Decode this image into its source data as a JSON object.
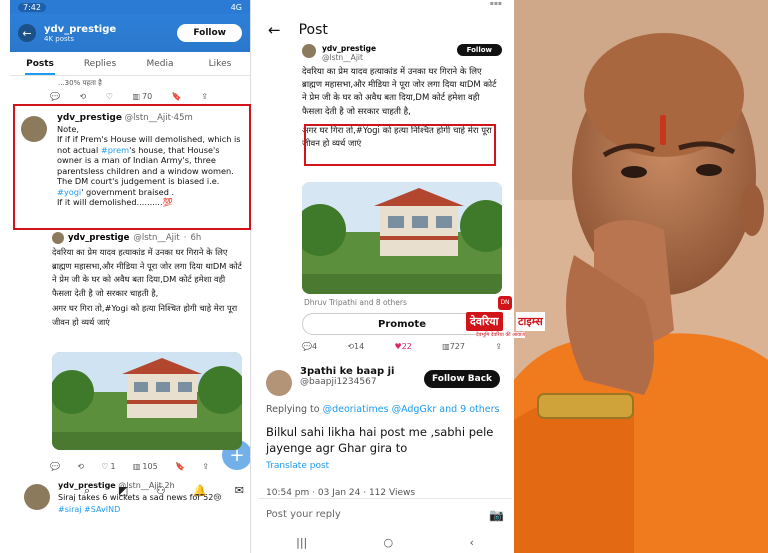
{
  "left": {
    "status_time": "7:42",
    "status_signal": "4G",
    "profile_name": "ydv_prestige",
    "profile_posts": "4K posts",
    "follow_label": "Follow",
    "tabs": [
      "Posts",
      "Replies",
      "Media",
      "Likes"
    ],
    "prev_text": "...30% पहता है",
    "prev_actions": {
      "views": "70"
    },
    "note": {
      "name": "ydv_prestige",
      "handle": "@lstn__Ajit",
      "time": "45m",
      "line1": "Note,",
      "line2": " If if if Prem's House will demolished, which is not actual ",
      "tag_prem": "#prem",
      "line3": "'s house, that House's owner is  a man of Indian Army's, three parentsless  children and a window women. The DM court's judgement is biased i.e. ",
      "tag_yogi": "#yogi",
      "line4": "' government braised .",
      "line5": " If it will demolished..........💯"
    },
    "quote": {
      "name": "ydv_prestige",
      "handle": "@lstn__Ajit",
      "time": "6h",
      "text": "देवरिया का प्रेम यादव हत्याकांड में उनका घर गिराने के लिए ब्राह्मण महासभा,और मीडिया ने पूरा जोर लगा दिया थाDM कोर्ट ने प्रेम जी के घर को अवैध बता दिया,DM कोर्ट हमेशा वही फैसला देती है जो सरकार चाहती है,",
      "text2": "अगर घर गिरा तो,#Yogi को हत्या निश्चित होगी चाहे मेरा पूरा जीवन हो व्यर्थ जाएं"
    },
    "actions2": {
      "likes": "1",
      "views": "105"
    },
    "bottom": {
      "name": "ydv_prestige",
      "handle": "@lstn__Ajit",
      "time": "2h",
      "text": "Siraj takes 6 wickets a sad news for 52😢",
      "tags": "#siraj #SAvIND"
    }
  },
  "mid": {
    "title": "Post",
    "mini_name": "ydv_prestige",
    "mini_handle": "@lstn__Ajit",
    "mini_follow": "Follow",
    "text_main": "देवरिया का प्रेम यादव हत्याकांड में उनका घर गिराने के लिए ब्राह्मण महासभा,और मीडिया ने पूरा जोर लगा दिया थाDM कोर्ट ने प्रेम जी के घर को अवैध बता दिया,DM कोर्ट हमेशा वही फैसला देती है जो सरकार चाहती है,",
    "text_red": "अगर घर गिरा तो,#Yogi को हत्या निश्चित होगी चाहे मेरा पूरा जीवन हो व्यर्थ जाएं",
    "liked_by": "Dhruv Tripathi and 8 others",
    "promote": "Promote",
    "stats": {
      "replies": "4",
      "reposts": "14",
      "likes": "22",
      "views": "727"
    },
    "reply_name": "3pathi ke baap ji",
    "reply_handle": "@baapji1234567",
    "follow_back": "Follow Back",
    "replying_prefix": "Replying to ",
    "replying_to": "@deoriatimes @AdgGkr and 9 others",
    "comment": "Bilkul sahi likha hai post me ,sabhi pele jayenge agr Ghar gira to",
    "translate": "Translate post",
    "meta": "10:54 pm · 03 Jan 24 · 112 Views",
    "reply_placeholder": "Post your reply"
  },
  "logo": {
    "word1": "देवरिया",
    "word2": "टाइम्स",
    "sub": "देवभूमि देवरिया की आवाज",
    "mark": "DN"
  }
}
